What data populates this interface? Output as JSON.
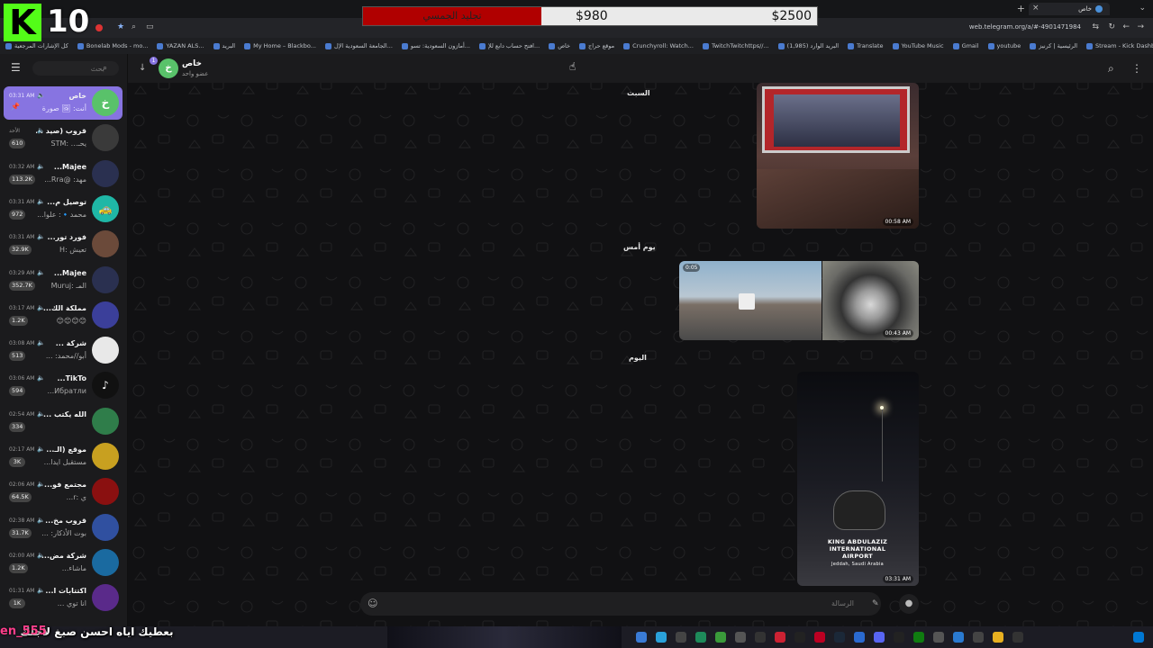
{
  "overlay": {
    "logo_letter": "K",
    "viewer_count": "10",
    "goal": {
      "label": "تجليد الجمسي",
      "current": "$980",
      "target": "$2500",
      "progress": 0.392,
      "fill_color": "#b00000"
    },
    "chat_user": "en_555",
    "chat_message": "بعطيك اياه احسن صبغ لاجلك"
  },
  "browser": {
    "url": "web.telegram.org/a/#-4901471984",
    "tab_title": "خاص",
    "bookmarks": [
      "كل الإشارات المرجعية",
      "Bonelab Mods - mo...",
      "YAZAN ALS...",
      "البريد",
      "My Home – Blackbo...",
      "الجامعة السعودية الإل...",
      "أمازون السعودية: تسو...",
      "افتح حساب دابع للإ...",
      "خاص",
      "موقع حراج",
      "Crunchyroll: Watch...",
      "TwitchTwitchttps//...",
      "البريد الوارد (1,985)",
      "Translate",
      "YouTube Music",
      "Gmail",
      "youtube",
      "الرئيسية | كرنيز",
      "Stream - Kick Dashb...",
      "Kick",
      "Google"
    ]
  },
  "sidebar": {
    "search_placeholder": "بحث",
    "chats": [
      {
        "title": "خاص",
        "preview": "أنت: 🖼 صورة",
        "time": "03:31 AM",
        "badge": "",
        "avatar": "خ",
        "color": "#59c26a",
        "active": true
      },
      {
        "title": "قروب (صيد ...",
        "preview": "يحـ... :STM",
        "time": "الأحد",
        "badge": "610",
        "avatar": "",
        "color": "#3a3a3a"
      },
      {
        "title": "Majee...",
        "preview": "مهد: @Rra...",
        "time": "03:32 AM",
        "badge": "113.2K",
        "avatar": "",
        "color": "#2a3050"
      },
      {
        "title": "توصيل م...",
        "preview": "محمد🔹: علوا...",
        "time": "03:31 AM",
        "badge": "972",
        "avatar": "🚕",
        "color": "#1fb7a6"
      },
      {
        "title": "فورد تور...",
        "preview": "تعيش :H",
        "time": "03:31 AM",
        "badge": "32.9K",
        "avatar": "",
        "color": "#6b4a3a"
      },
      {
        "title": "Majee...",
        "preview": "المـ :Muruj",
        "time": "03:29 AM",
        "badge": "352.7K",
        "avatar": "",
        "color": "#2a3050"
      },
      {
        "title": "مملكة الك...",
        "preview": "😊😊😊😊",
        "time": "03:17 AM",
        "badge": "1.2K",
        "avatar": "",
        "color": "#3b3f9a"
      },
      {
        "title": "شركة ...",
        "preview": "أبو//محمد: ...",
        "time": "03:08 AM",
        "badge": "513",
        "avatar": "",
        "color": "#e8e8e8"
      },
      {
        "title": "TikTo...",
        "preview": "Ибратли...",
        "time": "03:06 AM",
        "badge": "594",
        "avatar": "♪",
        "color": "#111111"
      },
      {
        "title": "الله يكتب ...",
        "preview": "",
        "time": "02:54 AM",
        "badge": "334",
        "avatar": "",
        "color": "#2f7d4a"
      },
      {
        "title": "موقع (الـ...",
        "preview": "مستقبل ايدا...",
        "time": "02:17 AM",
        "badge": "3K",
        "avatar": "",
        "color": "#c8a020"
      },
      {
        "title": "مجتمع فو...",
        "preview": "ي :r...",
        "time": "02:06 AM",
        "badge": "64.5K",
        "avatar": "",
        "color": "#8a1010"
      },
      {
        "title": "قروب مخ...",
        "preview": "بوت الأذكار: ...",
        "time": "02:38 AM",
        "badge": "31.7K",
        "avatar": "",
        "color": "#3050a0"
      },
      {
        "title": "شركة مض...",
        "preview": "ماشاء...",
        "time": "02:00 AM",
        "badge": "1.2K",
        "avatar": "",
        "color": "#1a6aa0"
      },
      {
        "title": "اكتتابات ا...",
        "preview": "انا توي ...",
        "time": "01:31 AM",
        "badge": "1K",
        "avatar": "",
        "color": "#5a2a8a"
      }
    ]
  },
  "chat": {
    "peer": {
      "name": "خاص",
      "status": "عضو واحد",
      "avatar": "خ"
    },
    "dates": [
      "السبت",
      "يوم أمس",
      "اليوم"
    ],
    "messages": [
      {
        "time": "00:58 AM"
      },
      {
        "time": "00:43 AM",
        "duration": "0:05"
      },
      {
        "time": "03:31 AM",
        "caption": [
          "KING ABDULAZIZ",
          "INTERNATIONAL",
          "AIRPORT",
          "Jeddah, Saudi Arabia"
        ]
      }
    ],
    "composer_placeholder": "الرسالة"
  }
}
